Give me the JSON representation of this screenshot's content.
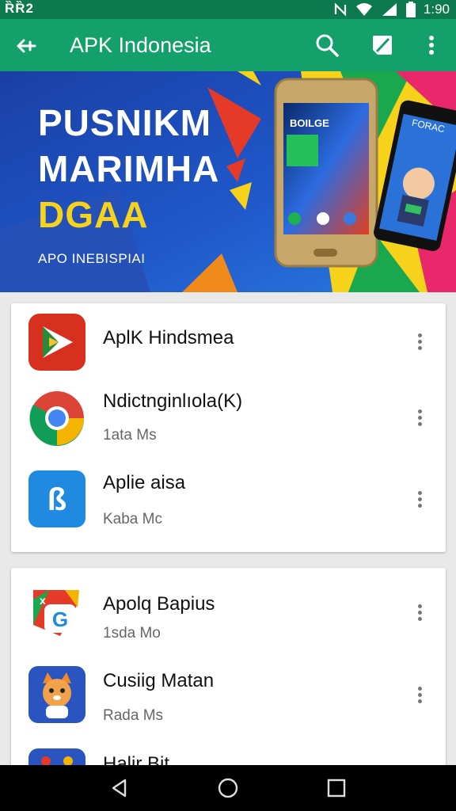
{
  "status_bar": {
    "left_text": "ȐȐ2",
    "time": "1:90"
  },
  "app_bar": {
    "title": "APK Indonesia"
  },
  "icons": {
    "back": "back-arrow-icon",
    "search": "search-icon",
    "edit": "edit-icon",
    "overflow": "more-vert-icon"
  },
  "banner": {
    "line1": "PUSNIKM",
    "line2": "MARIMHA",
    "line3": "DGAA",
    "subtitle": "APO INEBISPIAI",
    "phone_left_label": "BOILGE",
    "phone_right_label": "FORAC"
  },
  "card1": {
    "items": [
      {
        "name": "AplK Hindsmea",
        "meta": "",
        "icon": "apk-store-icon"
      },
      {
        "name": "Ndictnginlıola(K)",
        "meta": "1ata Ms",
        "icon": "chrome-icon"
      },
      {
        "name": "Aplie aisa",
        "meta": "Kaba Mc",
        "icon": "blue-app-icon"
      }
    ]
  },
  "card2": {
    "items": [
      {
        "name": "Apolq Bapius",
        "meta": "1sda Mo",
        "icon": "google-colorful-icon"
      },
      {
        "name": "Cusiig Matan",
        "meta": "Rada Ms",
        "icon": "cat-mascot-icon"
      },
      {
        "name": "Halir Bit",
        "meta": "",
        "icon": "partial-app-icon"
      }
    ]
  },
  "colors": {
    "status_bar": "#0c7a4e",
    "app_bar": "#13a06a",
    "background": "#e9e9e9",
    "card": "#ffffff"
  }
}
